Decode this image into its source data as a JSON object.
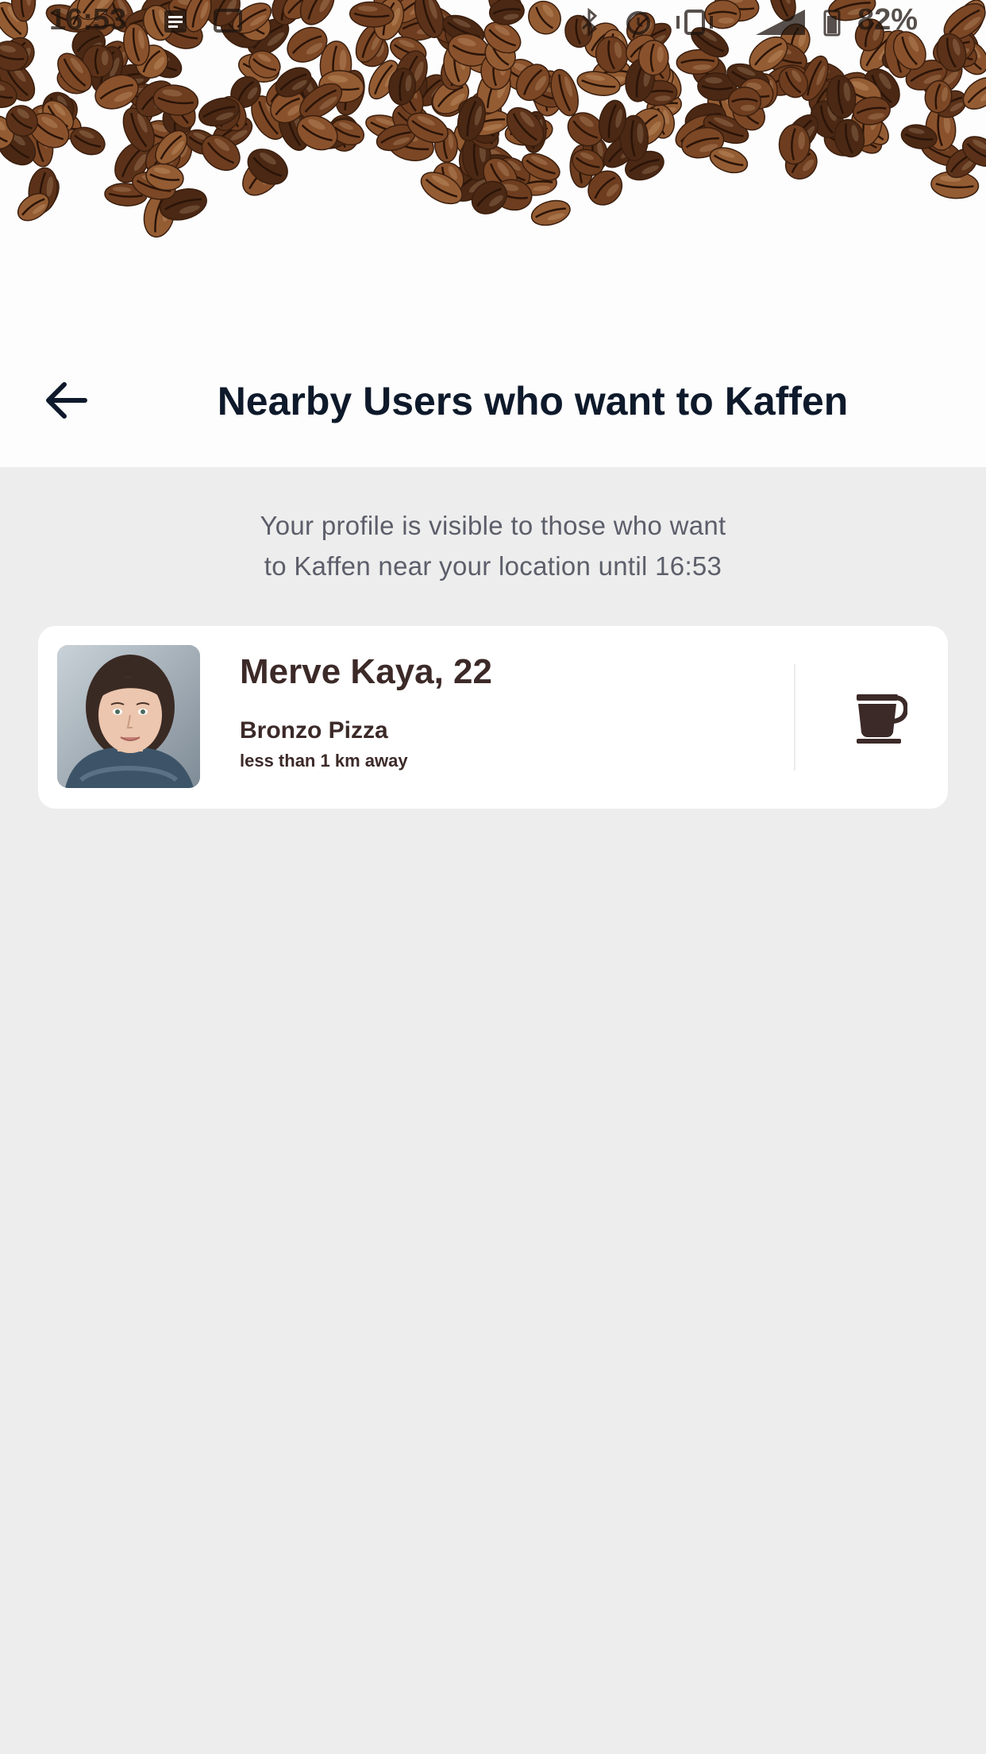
{
  "status_bar": {
    "time": "16:53",
    "battery": "82%",
    "icons": [
      "notes-icon",
      "message-icon",
      "bluetooth-icon",
      "alarm-icon",
      "vibrate-icon",
      "signal-icon",
      "battery-icon"
    ]
  },
  "header": {
    "back_icon": "arrow-left-icon",
    "title": "Nearby Users who want to Kaffen"
  },
  "notice": {
    "line1": "Your profile is visible to those who want",
    "line2": "to Kaffen near your location until 16:53"
  },
  "users": [
    {
      "name": "Merve Kaya, 22",
      "place": "Bronzo Pizza",
      "distance": "less than 1 km away",
      "action_icon": "coffee-cup-icon"
    }
  ],
  "colors": {
    "title": "#0e1a2b",
    "card_text": "#3c2a28",
    "notice_text": "#5c5e6a",
    "background": "#ededed",
    "card": "#ffffff"
  }
}
